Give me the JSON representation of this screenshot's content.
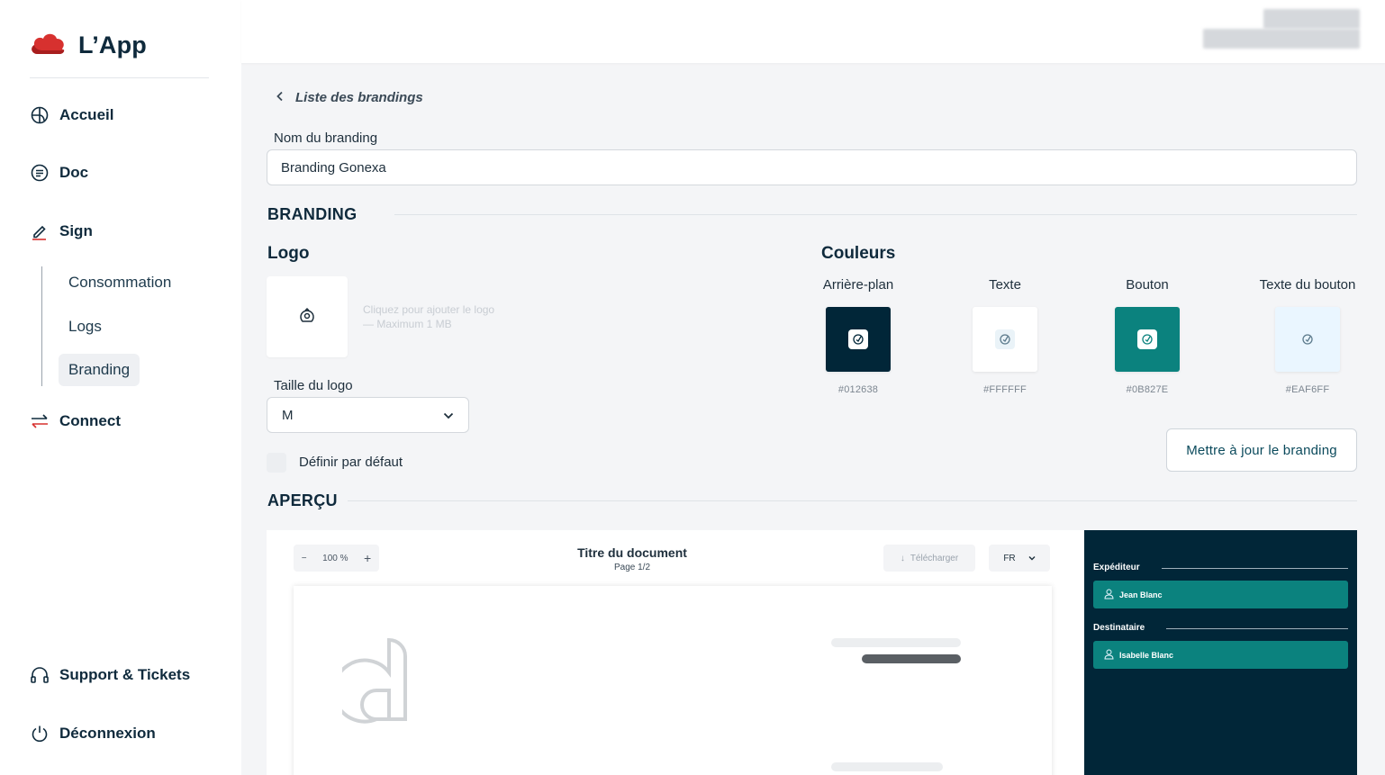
{
  "app": {
    "name": "L’App"
  },
  "sidebar": {
    "nav": [
      {
        "label": "Accueil",
        "icon": "globe-icon"
      },
      {
        "label": "Doc",
        "icon": "document-icon"
      },
      {
        "label": "Sign",
        "icon": "pen-icon"
      },
      {
        "label": "Connect",
        "icon": "arrows-swap-icon"
      }
    ],
    "sign_sub": [
      {
        "label": "Consommation"
      },
      {
        "label": "Logs"
      },
      {
        "label": "Branding",
        "active": true
      }
    ],
    "bottom": [
      {
        "label": "Support & Tickets",
        "icon": "headset-icon"
      },
      {
        "label": "Déconnexion",
        "icon": "power-icon"
      }
    ]
  },
  "breadcrumb": {
    "back_label": "Liste des brandings"
  },
  "form": {
    "name_label": "Nom du branding",
    "name_value": "Branding Gonexa",
    "branding_title": "BRANDING",
    "logo_title": "Logo",
    "logo_hint_line1": "Cliquez pour ajouter le logo",
    "logo_hint_line2": "— Maximum 1 MB",
    "logo_size_label": "Taille du logo",
    "logo_size_value": "M",
    "default_label": "Définir par défaut",
    "default_checked": false,
    "colors_title": "Couleurs",
    "colors": [
      {
        "name": "Arrière-plan",
        "hex": "#012638"
      },
      {
        "name": "Texte",
        "hex": "#FFFFFF"
      },
      {
        "name": "Bouton",
        "hex": "#0B827E"
      },
      {
        "name": "Texte du bouton",
        "hex": "#EAF6FF"
      }
    ],
    "update_button": "Mettre à jour le branding"
  },
  "preview": {
    "title": "APERÇU",
    "zoom": "100 %",
    "doc_title": "Titre du document",
    "doc_page": "Page 1/2",
    "download_label": "Télécharger",
    "lang": "FR",
    "sender_label": "Expéditeur",
    "sender_name": "Jean Blanc",
    "recipient_label": "Destinataire",
    "recipient_name": "Isabelle Blanc"
  },
  "colors": {
    "accent": "#D7312F",
    "primary_dark": "#012638",
    "button": "#0B827E"
  }
}
